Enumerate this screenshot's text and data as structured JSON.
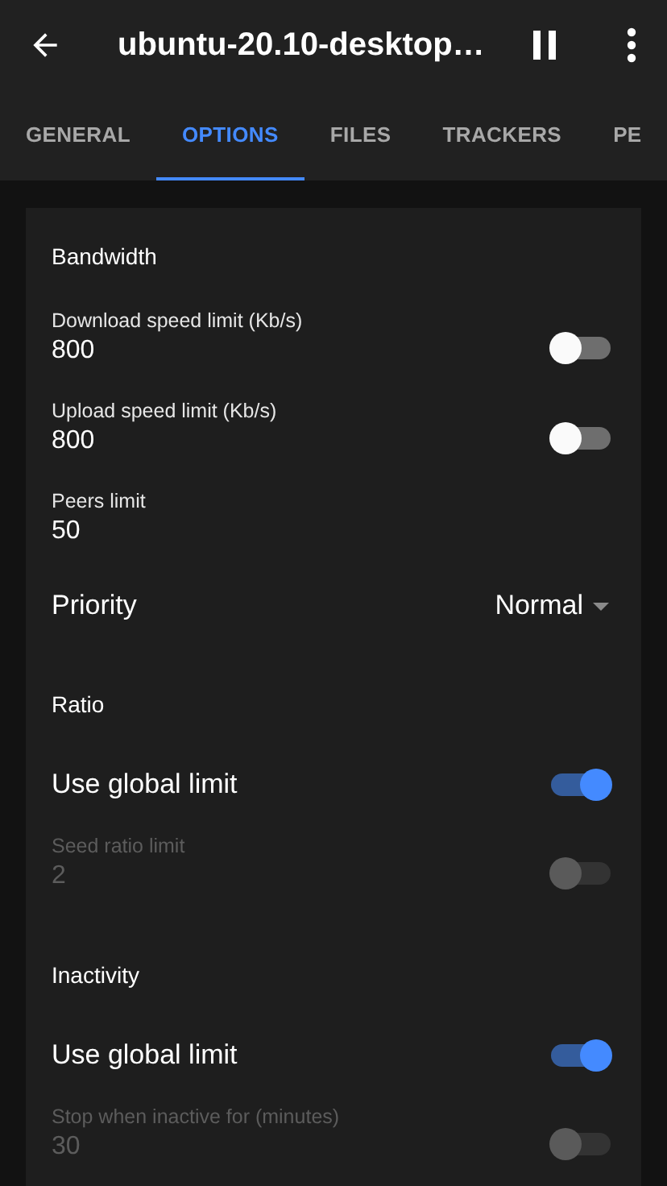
{
  "app_bar": {
    "title": "ubuntu-20.10-desktop…"
  },
  "tabs": [
    {
      "label": "GENERAL",
      "selected": false
    },
    {
      "label": "OPTIONS",
      "selected": true
    },
    {
      "label": "FILES",
      "selected": false
    },
    {
      "label": "TRACKERS",
      "selected": false
    },
    {
      "label": "PE",
      "selected": false
    }
  ],
  "options": [
    {
      "kind": "header",
      "label": "Bandwidth"
    },
    {
      "kind": "field",
      "label": "Download speed limit (Kb/s)",
      "value": "800",
      "on": false,
      "disabled": false
    },
    {
      "kind": "field",
      "label": "Upload speed limit (Kb/s)",
      "value": "800",
      "on": false,
      "disabled": false
    },
    {
      "kind": "text",
      "label": "Peers limit",
      "value": "50"
    },
    {
      "kind": "select",
      "label": "Priority",
      "value": "Normal"
    },
    {
      "kind": "header",
      "label": "Ratio"
    },
    {
      "kind": "switch",
      "label": "Use global limit",
      "on": true
    },
    {
      "kind": "field",
      "label": "Seed ratio limit",
      "value": "2",
      "on": false,
      "disabled": true
    },
    {
      "kind": "header",
      "label": "Inactivity"
    },
    {
      "kind": "switch",
      "label": "Use global limit",
      "on": true
    },
    {
      "kind": "field",
      "label": "Stop when inactive for (minutes)",
      "value": "30",
      "on": false,
      "disabled": true
    }
  ]
}
